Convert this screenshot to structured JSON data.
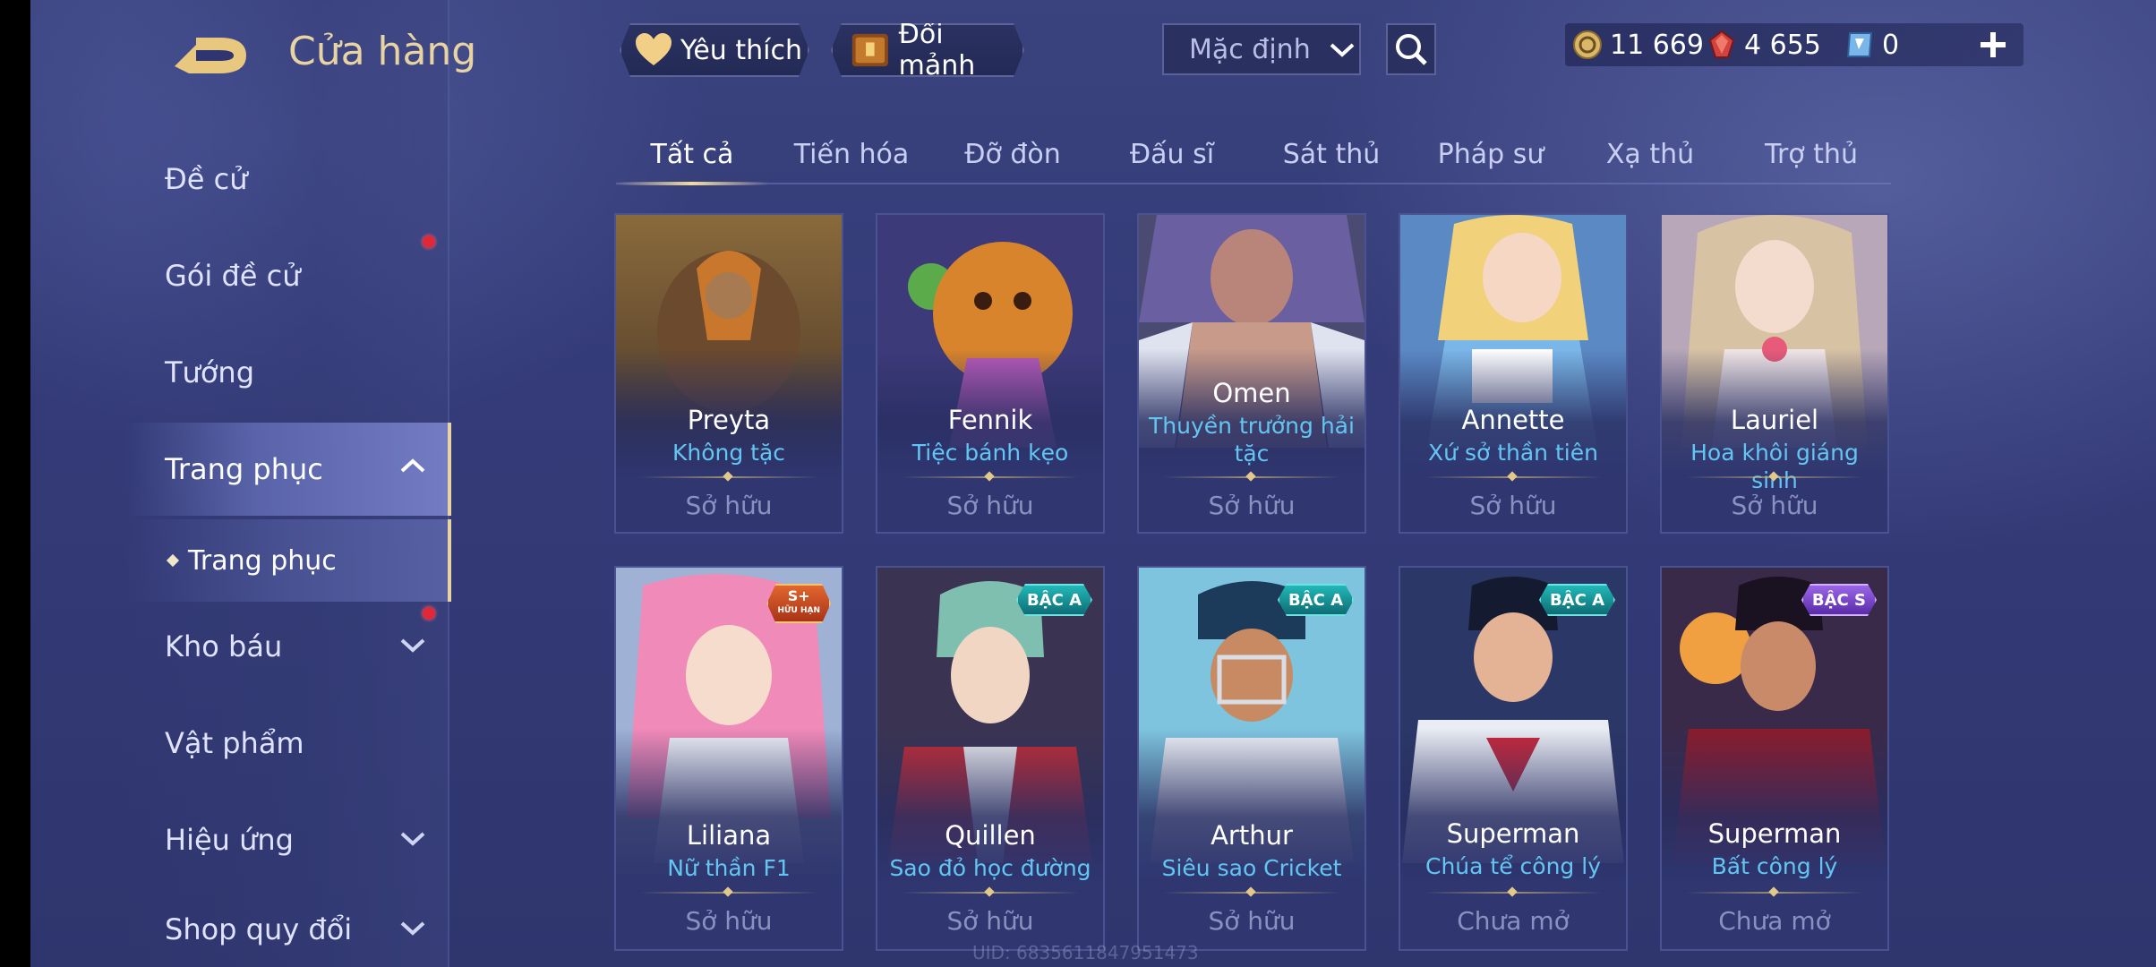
{
  "header": {
    "title": "Cửa hàng",
    "favorites_label": "Yêu thích",
    "exchange_label": "Đổi mảnh",
    "sort_value": "Mặc định",
    "currencies": [
      {
        "name": "gold-coin",
        "value": "11 669"
      },
      {
        "name": "ruby-gem",
        "value": "4 655"
      },
      {
        "name": "voucher",
        "value": "0"
      }
    ]
  },
  "sidebar": {
    "items": [
      {
        "label": "Đề cử"
      },
      {
        "label": "Gói đề cử"
      },
      {
        "label": "Tướng"
      },
      {
        "label": "Trang phục"
      },
      {
        "label": "Kho báu"
      },
      {
        "label": "Vật phẩm"
      },
      {
        "label": "Hiệu ứng"
      },
      {
        "label": "Shop quy đổi"
      }
    ],
    "sub_item": "Trang phục"
  },
  "tabs": [
    "Tất cả",
    "Tiến hóa",
    "Đỡ đòn",
    "Đấu sĩ",
    "Sát thủ",
    "Pháp sư",
    "Xạ thủ",
    "Trợ thủ"
  ],
  "cards": [
    {
      "hero": "Preyta",
      "skin": "Không tặc",
      "status": "Sở hữu",
      "badge": ""
    },
    {
      "hero": "Fennik",
      "skin": "Tiệc bánh kẹo",
      "status": "Sở hữu",
      "badge": ""
    },
    {
      "hero": "Omen",
      "skin": "Thuyền trưởng hải tặc",
      "status": "Sở hữu",
      "badge": ""
    },
    {
      "hero": "Annette",
      "skin": "Xứ sở thần tiên",
      "status": "Sở hữu",
      "badge": ""
    },
    {
      "hero": "Lauriel",
      "skin": "Hoa khôi giáng sinh",
      "status": "Sở hữu",
      "badge": ""
    },
    {
      "hero": "Liliana",
      "skin": "Nữ thần F1",
      "status": "Sở hữu",
      "badge": "S+",
      "badge_sub": "HỮU HẠN"
    },
    {
      "hero": "Quillen",
      "skin": "Sao đỏ học đường",
      "status": "Sở hữu",
      "badge": "BẬC A"
    },
    {
      "hero": "Arthur",
      "skin": "Siêu sao Cricket",
      "status": "Sở hữu",
      "badge": "BẬC A"
    },
    {
      "hero": "Superman",
      "skin": "Chúa tể công lý",
      "status": "Chưa mở",
      "badge": "BẬC A"
    },
    {
      "hero": "Superman",
      "skin": "Bất công lý",
      "status": "Chưa mở",
      "badge": "BẬC S"
    }
  ],
  "footer": {
    "uid": "UID: 6835611847951473"
  },
  "colors": {
    "accent_gold": "#e8d3a3",
    "skin_blue": "#63c6f2",
    "notify_red": "#e02838",
    "badge_a": "#1aa0a8",
    "badge_s": "#7b4fd0"
  }
}
